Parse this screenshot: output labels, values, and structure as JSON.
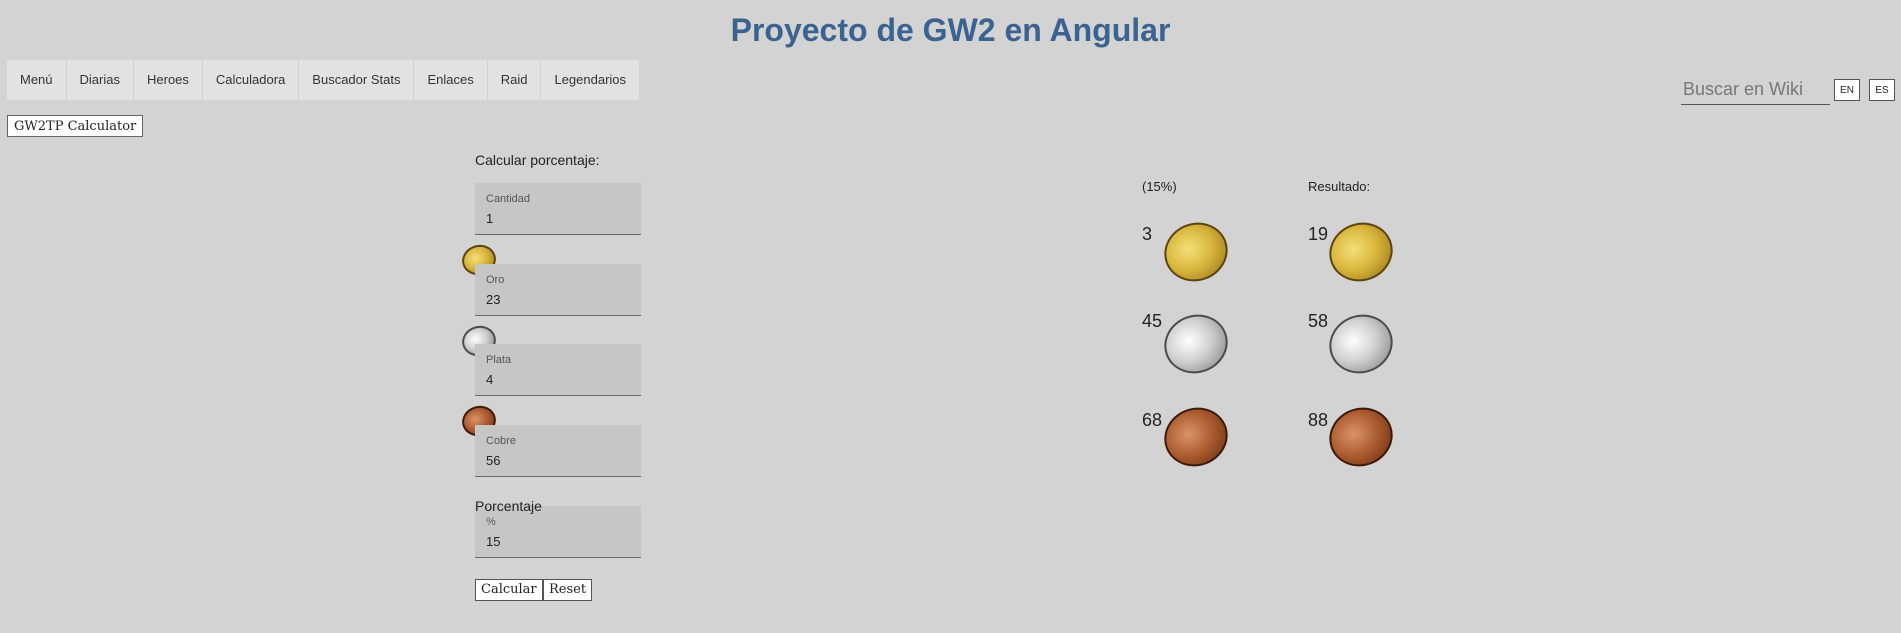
{
  "header": {
    "title": "Proyecto de GW2 en Angular"
  },
  "nav": {
    "items": [
      "Menú",
      "Diarias",
      "Heroes",
      "Calculadora",
      "Buscador Stats",
      "Enlaces",
      "Raid",
      "Legendarios"
    ]
  },
  "search": {
    "placeholder": "Buscar en Wiki"
  },
  "languages": [
    "EN",
    "ES"
  ],
  "calculator_tab": "GW2TP Calculator",
  "form": {
    "title": "Calcular porcentaje:",
    "fields": [
      {
        "label": "Cantidad",
        "value": "1"
      },
      {
        "label": "Oro",
        "value": "23",
        "coin": "gold"
      },
      {
        "label": "Plata",
        "value": "4",
        "coin": "silver"
      },
      {
        "label": "Cobre",
        "value": "56",
        "coin": "copper"
      }
    ],
    "percent_section_label": "Porcentaje",
    "percent_field": {
      "label": "%",
      "value": "15"
    },
    "calculate_button": "Calcular",
    "reset_button": "Reset"
  },
  "results": {
    "percent_header": "(15%)",
    "result_header": "Resultado:",
    "percent_values": {
      "gold": "3",
      "silver": "45",
      "copper": "68"
    },
    "result_values": {
      "gold": "19",
      "silver": "58",
      "copper": "88"
    }
  },
  "colors": {
    "title": "#3a6391",
    "background": "#d3d3d3"
  }
}
